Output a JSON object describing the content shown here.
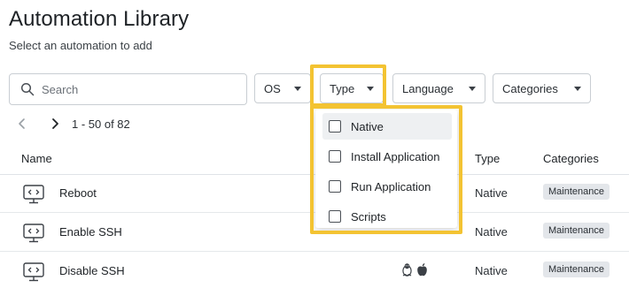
{
  "header": {
    "title": "Automation Library",
    "subtitle": "Select an automation to add"
  },
  "search": {
    "placeholder": "Search",
    "value": ""
  },
  "filters": {
    "os": "OS",
    "type": "Type",
    "language": "Language",
    "categories": "Categories"
  },
  "pagination": {
    "range_text": "1 - 50 of 82"
  },
  "table": {
    "columns": {
      "name": "Name",
      "type": "Type",
      "categories": "Categories"
    },
    "rows": [
      {
        "name": "Reboot",
        "type": "Native",
        "category": "Maintenance",
        "os_icons": []
      },
      {
        "name": "Enable SSH",
        "type": "Native",
        "category": "Maintenance",
        "os_icons": []
      },
      {
        "name": "Disable SSH",
        "type": "Native",
        "category": "Maintenance",
        "os_icons": [
          "linux-icon",
          "apple-icon"
        ]
      }
    ]
  },
  "type_dropdown": {
    "items": [
      {
        "label": "Native",
        "checked": false,
        "hovered": true
      },
      {
        "label": "Install Application",
        "checked": false,
        "hovered": false
      },
      {
        "label": "Run Application",
        "checked": false,
        "hovered": false
      },
      {
        "label": "Scripts",
        "checked": false,
        "hovered": false
      }
    ]
  },
  "colors": {
    "highlight": "#f3c332",
    "badge_bg": "#e3e6ea",
    "border": "#c9ced3"
  }
}
